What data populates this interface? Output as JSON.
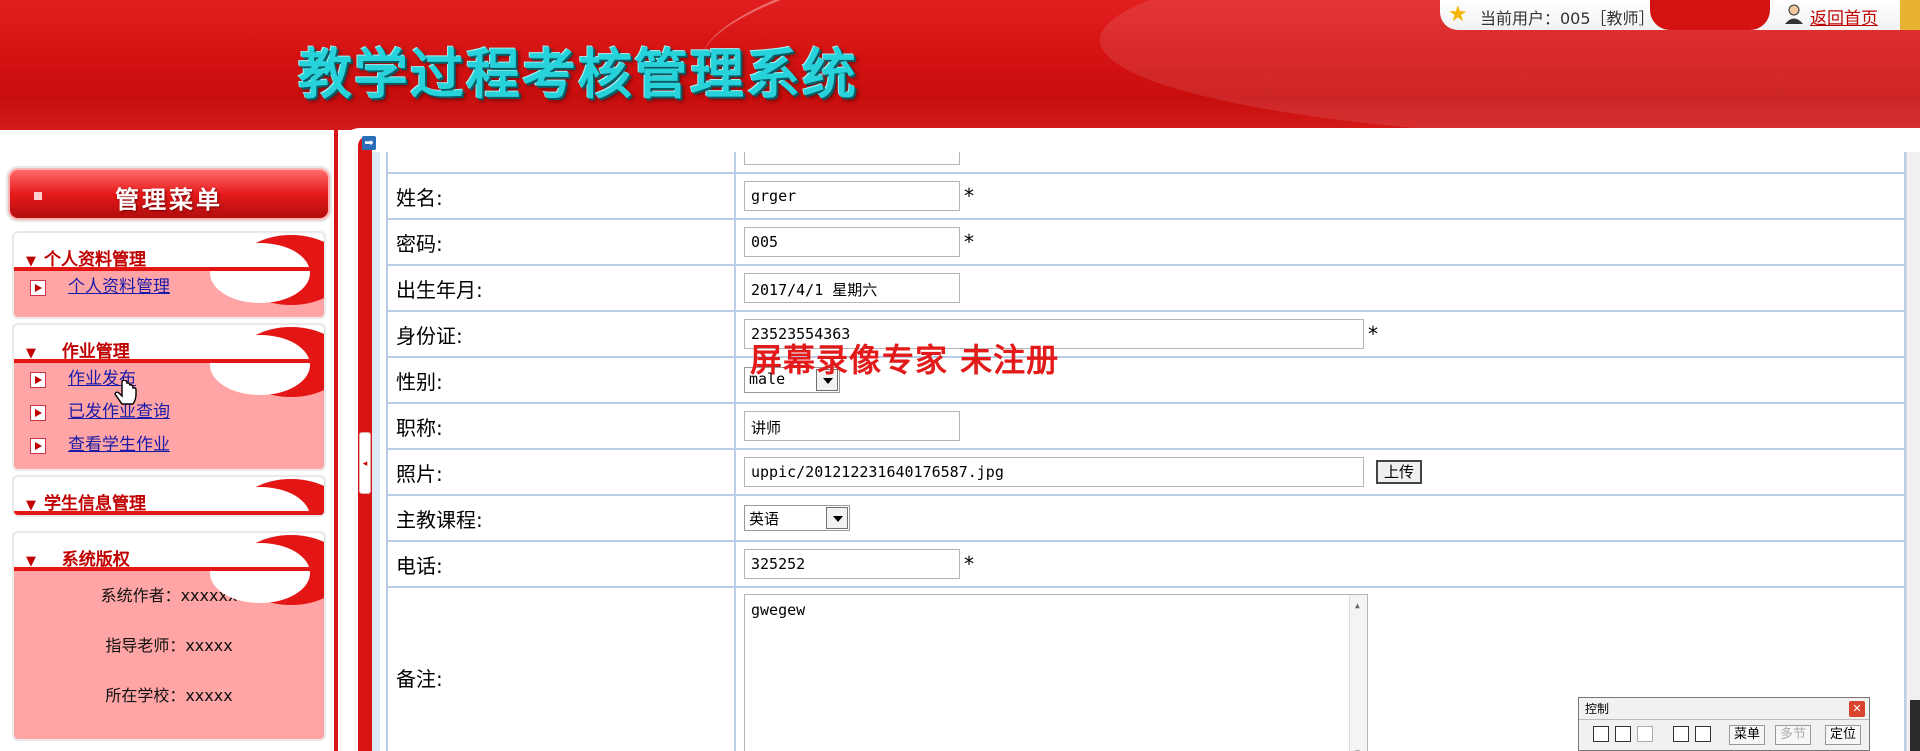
{
  "header": {
    "title": "教学过程考核管理系统",
    "current_user": "当前用户：005［教师］",
    "home_link": "返回首页"
  },
  "sidebar": {
    "menu_title": "管理菜单",
    "panels": [
      {
        "title": "个人资料管理",
        "items": [
          "个人资料管理"
        ]
      },
      {
        "title": "作业管理",
        "items": [
          "作业发布",
          "已发作业查询",
          "查看学生作业"
        ]
      },
      {
        "title": "学生信息管理",
        "items": []
      },
      {
        "title": "系统版权",
        "lines": [
          "系统作者：xxxxxx",
          "指导老师：xxxxx",
          "所在学校：xxxxx"
        ]
      }
    ]
  },
  "form": {
    "fields": [
      {
        "label": "姓名:",
        "value": "grger",
        "required": "*"
      },
      {
        "label": "密码:",
        "value": "005",
        "required": "*"
      },
      {
        "label": "出生年月:",
        "value": "2017/4/1 星期六"
      },
      {
        "label": "身份证:",
        "value": "23523554363",
        "required": "*"
      },
      {
        "label": "性别:",
        "value": "male"
      },
      {
        "label": "职称:",
        "value": "讲师"
      },
      {
        "label": "照片:",
        "value": "uppic/201212231640176587.jpg",
        "button": "上传"
      },
      {
        "label": "主教课程:",
        "value": "英语"
      },
      {
        "label": "电话:",
        "value": "325252",
        "required": "*"
      },
      {
        "label": "备注:",
        "value": "gwegew"
      }
    ]
  },
  "watermark": "屏幕录像专家  未注册",
  "control": {
    "title": "控制",
    "menu": "菜单",
    "multi": "多节",
    "locate": "定位"
  },
  "colors": {
    "header_red": "#d41212",
    "title_cyan": "#27d2da",
    "panel_pink": "#ffa5a5",
    "table_border": "#b9cee6"
  }
}
